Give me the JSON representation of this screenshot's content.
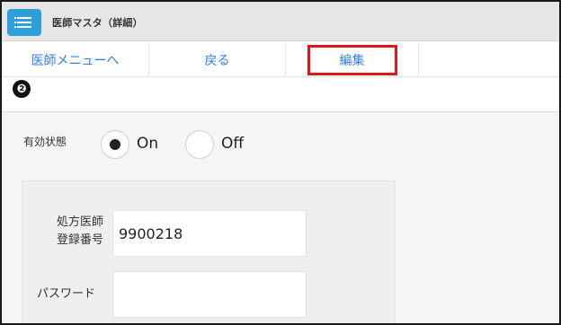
{
  "window": {
    "title": "医師マスタ（詳細）",
    "menu_icon": "hamburger-menu-icon"
  },
  "tabs": [
    {
      "label": "医師メニューへ"
    },
    {
      "label": "戻る"
    },
    {
      "label": "編集"
    }
  ],
  "annotation": {
    "marker": "❷",
    "highlight_color": "#e0161d"
  },
  "form": {
    "status_label": "有効状態",
    "status_options": [
      {
        "label": "On",
        "selected": true
      },
      {
        "label": "Off",
        "selected": false
      }
    ],
    "registration_label_line1": "処方医師",
    "registration_label_line2": "登録番号",
    "registration_value": "9900218",
    "password_label": "パスワード",
    "password_value": ""
  },
  "colors": {
    "accent": "#2f9fd9",
    "link": "#2f80ed"
  }
}
